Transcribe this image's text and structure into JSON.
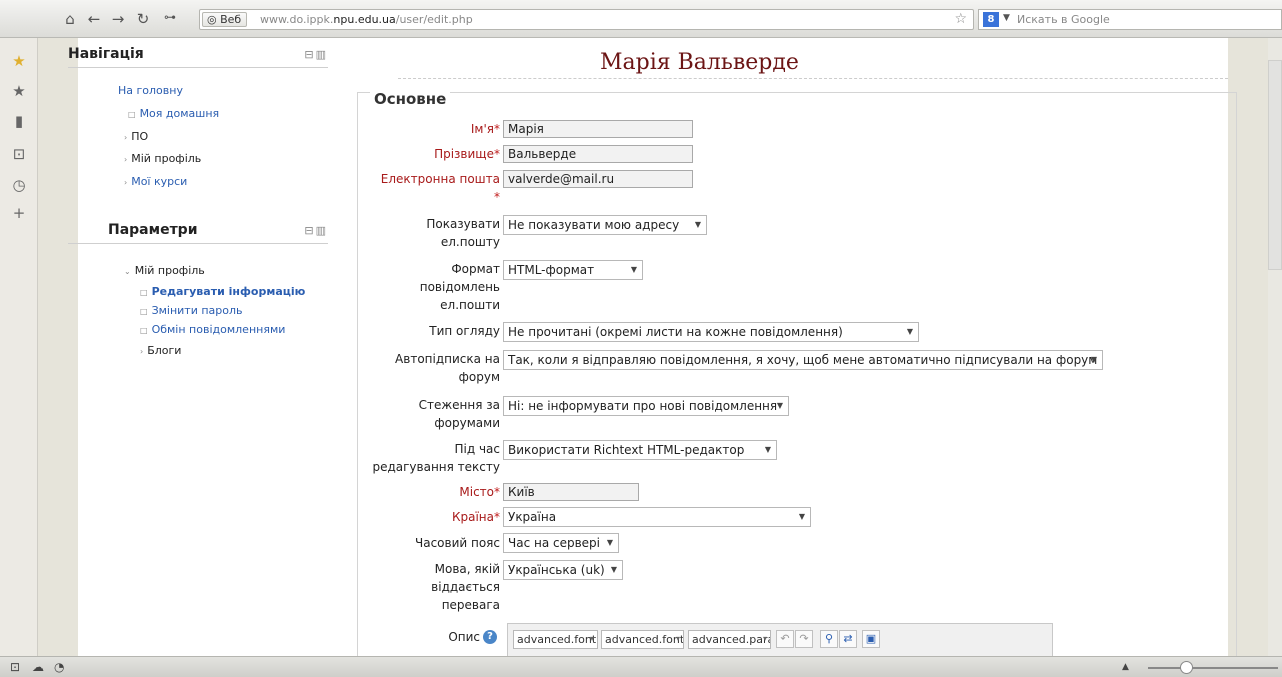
{
  "browser": {
    "web_tag": "Веб",
    "url_prefix": "www.do.ippk.",
    "url_domain": "npu.edu.ua",
    "url_path": "/user/edit.php",
    "search_placeholder": "Искать в Google",
    "search_engine_letter": "8"
  },
  "navigation": {
    "title": "Навігація",
    "home": "На головну",
    "items": [
      {
        "label": "Моя домашня",
        "type": "link"
      },
      {
        "label": "ПО",
        "type": "plain"
      },
      {
        "label": "Мій профіль",
        "type": "plain"
      },
      {
        "label": "Мої курси",
        "type": "link"
      }
    ]
  },
  "settings": {
    "title": "Параметри",
    "root": "Мій профіль",
    "items": [
      {
        "label": "Редагувати інформацію"
      },
      {
        "label": "Змінити пароль"
      },
      {
        "label": "Обмін повідомленнями"
      },
      {
        "label": "Блоги"
      }
    ]
  },
  "page": {
    "title": "Марія Вальверде",
    "section": "Основне"
  },
  "form": {
    "firstname": {
      "label": "Ім'я",
      "value": "Марія"
    },
    "lastname": {
      "label": "Прізвище",
      "value": "Вальверде"
    },
    "email": {
      "label": "Електронна пошта",
      "value": "valverde@mail.ru"
    },
    "maildisplay": {
      "label_1": "Показувати",
      "label_2": "ел.пошту",
      "value": "Не показувати мою адресу"
    },
    "mailformat": {
      "label_1": "Формат",
      "label_2": "повідомлень",
      "label_3": "ел.пошти",
      "value": "HTML-формат"
    },
    "maildigest": {
      "label": "Тип огляду",
      "value": "Не прочитані (окремі листи на кожне повідомлення)"
    },
    "autosubscribe": {
      "label_1": "Автопідписка на",
      "label_2": "форум",
      "value": "Так, коли я відправляю повідомлення, я хочу, щоб мене автоматично підписували на форум"
    },
    "trackforums": {
      "label_1": "Стеження за",
      "label_2": "форумами",
      "value": "Ні: не інформувати про нові повідомлення"
    },
    "htmleditor": {
      "label_1": "Під час",
      "label_2": "редагування тексту",
      "value": "Використати Richtext HTML-редактор"
    },
    "city": {
      "label": "Місто",
      "value": "Київ"
    },
    "country": {
      "label": "Країна",
      "value": "Україна"
    },
    "timezone": {
      "label": "Часовий пояс",
      "value": "Час на сервері"
    },
    "lang": {
      "label_1": "Мова, якій",
      "label_2": "віддається",
      "label_3": "перевага",
      "value": "Українська (uk)"
    },
    "description": {
      "label": "Опис"
    }
  },
  "editor": {
    "selects": [
      "advanced.font",
      "advanced.font",
      "advanced.para"
    ]
  }
}
